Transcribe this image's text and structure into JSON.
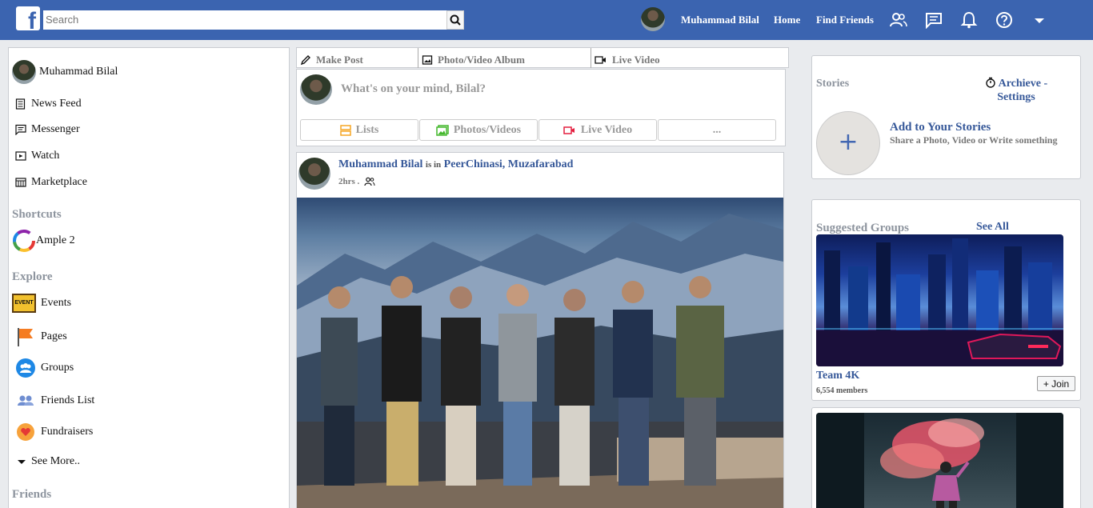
{
  "header": {
    "logo": "f",
    "search_placeholder": "Search",
    "user_name": "Muhammad Bilal",
    "nav": [
      "Home",
      "Find Friends"
    ],
    "icons": [
      "friends-icon",
      "messages-icon",
      "notifications-icon",
      "help-icon",
      "dropdown-icon"
    ],
    "brand_color": "#3b64b0"
  },
  "sidebar": {
    "user_name": "Muhammad Bilal",
    "items": [
      {
        "label": "News Feed",
        "icon": "news-feed-icon"
      },
      {
        "label": "Messenger",
        "icon": "messenger-icon"
      },
      {
        "label": "Watch",
        "icon": "watch-icon"
      },
      {
        "label": "Marketplace",
        "icon": "marketplace-icon"
      }
    ],
    "shortcuts_heading": "Shortcuts",
    "shortcuts": [
      {
        "label": "Ample 2",
        "icon": "ample-icon"
      }
    ],
    "explore_heading": "Explore",
    "explore": [
      {
        "label": "Events",
        "icon": "events-icon",
        "badge": "EVENT"
      },
      {
        "label": "Pages",
        "icon": "pages-icon"
      },
      {
        "label": "Groups",
        "icon": "groups-icon"
      },
      {
        "label": "Friends List",
        "icon": "friends-list-icon"
      },
      {
        "label": "Fundraisers",
        "icon": "fundraisers-icon"
      }
    ],
    "see_more": "See More..",
    "friends_heading": "Friends"
  },
  "composer": {
    "tabs": [
      "Make Post",
      "Photo/Video Album",
      "Live Video"
    ],
    "placeholder": "What's on your mind, Bilal?",
    "actions": [
      "Lists",
      "Photos/Videos",
      "Live Video",
      "..."
    ]
  },
  "post": {
    "author": "Muhammad Bilal",
    "connector": "is in",
    "location": "PeerChinasi, Muzafarabad",
    "time": "2hrs ."
  },
  "stories": {
    "heading": "Stories",
    "archive_link_line1": "Archieve -",
    "archive_link_line2": "Settings",
    "add_title": "Add to Your Stories",
    "add_subtitle": "Share a Photo, Video or Write something"
  },
  "suggested_groups": {
    "heading": "Suggested Groups",
    "see_all": "See All",
    "groups": [
      {
        "name": "Team 4K",
        "members": "6,554 members",
        "join_label": "+ Join"
      }
    ]
  }
}
